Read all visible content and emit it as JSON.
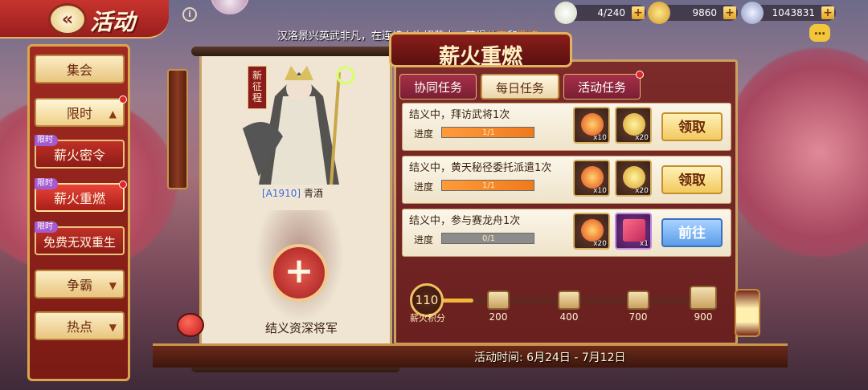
{
  "header": {
    "back_icon": "double-chevron-left-icon",
    "title": "活动",
    "info_icon": "i"
  },
  "resources": [
    {
      "icon": "bun-icon",
      "value": "4/240"
    },
    {
      "icon": "gold-ingot-icon",
      "value": "9860"
    },
    {
      "icon": "silver-coin-icon",
      "value": "1043831"
    }
  ],
  "ticker": {
    "prefix": "汉洛景兴英武非凡，在连续十次招募中，获得",
    "name1": "关索",
    "mid": "和",
    "name2": "曹植",
    "suffix": "，"
  },
  "nav": {
    "items": [
      {
        "label": "集会",
        "tag": ""
      },
      {
        "label": "限时",
        "tag": ""
      },
      {
        "label": "薪火密令",
        "tag": "限时"
      },
      {
        "label": "薪火重燃",
        "tag": "限时"
      },
      {
        "label": "免费无双重生",
        "tag": "限时"
      },
      {
        "label": "争霸",
        "tag": ""
      },
      {
        "label": "热点",
        "tag": ""
      }
    ]
  },
  "hero": {
    "tag": "新征程",
    "code": "[A1910]",
    "name": "青酒"
  },
  "slot": {
    "plus": "+",
    "label": "结义资深将军"
  },
  "panel": {
    "title": "薪火重燃"
  },
  "tabs": [
    {
      "label": "协同任务"
    },
    {
      "label": "每日任务"
    },
    {
      "label": "活动任务"
    }
  ],
  "tasks": [
    {
      "title": "结义中，拜访武将1次",
      "progress_label": "进度",
      "progress_text": "1/1",
      "progress": 1.0,
      "rewards": [
        {
          "icon": "fire-icon",
          "count": "x10"
        },
        {
          "icon": "gold-ingot-icon",
          "count": "x20"
        }
      ],
      "button": "领取",
      "button_style": "gold"
    },
    {
      "title": "结义中，黄天秘径委托派遣1次",
      "progress_label": "进度",
      "progress_text": "1/1",
      "progress": 1.0,
      "rewards": [
        {
          "icon": "fire-icon",
          "count": "x10"
        },
        {
          "icon": "gold-ingot-icon",
          "count": "x20"
        }
      ],
      "button": "领取",
      "button_style": "gold"
    },
    {
      "title": "结义中，参与赛龙舟1次",
      "progress_label": "进度",
      "progress_text": "0/1",
      "progress": 0.0,
      "rewards": [
        {
          "icon": "fire-icon",
          "count": "x20"
        },
        {
          "icon": "gift-box-icon",
          "count": "x1"
        }
      ],
      "button": "前往",
      "button_style": "blue"
    }
  ],
  "points": {
    "value": "110",
    "label": "薪火积分",
    "progress": 0.12,
    "milestones": [
      "200",
      "400",
      "700",
      "900"
    ]
  },
  "footer": {
    "time": "活动时间: 6月24日 - 7月12日"
  },
  "colors": {
    "accent": "#c8342e",
    "gold": "#e6b562",
    "panel": "#7c2a2a"
  }
}
